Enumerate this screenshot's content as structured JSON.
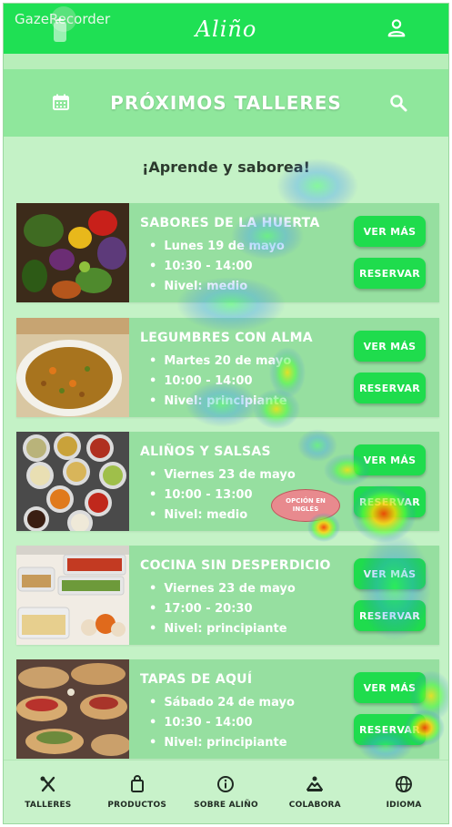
{
  "header": {
    "brand": "Aliño",
    "watermark": "GazeRecorder",
    "user_icon": "user-icon",
    "colors": {
      "header": "#1fe054",
      "background": "#c4f2c6",
      "button": "#1fdc4d"
    }
  },
  "section": {
    "title": "PRÓXIMOS TALLERES",
    "calendar_icon": "calendar-icon",
    "search_icon": "search-icon"
  },
  "tagline": "¡Aprende y saborea!",
  "workshops": [
    {
      "title": "SABORES DE LA HUERTA",
      "date": "Lunes 19 de mayo",
      "time": "10:30 - 14:00",
      "level": "Nivel: medio",
      "more": "VER MÁS",
      "reserve": "RESERVAR"
    },
    {
      "title": "LEGUMBRES CON ALMA",
      "date": "Martes 20 de mayo",
      "time": "10:00 - 14:00",
      "level": "Nivel: principiante",
      "more": "VER MÁS",
      "reserve": "RESERVAR"
    },
    {
      "title": "ALIÑOS Y SALSAS",
      "date": "Viernes 23 de mayo",
      "time": "10:00 - 13:00",
      "level": "Nivel: medio",
      "more": "VER MÁS",
      "reserve": "RESERVAR",
      "tip": "OPCIÓN EN INGLÉS"
    },
    {
      "title": "COCINA SIN DESPERDICIO",
      "date": "Viernes 23 de mayo",
      "time": "17:00 - 20:30",
      "level": "Nivel: principiante",
      "more": "VER MÁS",
      "reserve": "RESERVAR"
    },
    {
      "title": "TAPAS DE AQUÍ",
      "date": "Sábado 24 de mayo",
      "time": "10:30 - 14:00",
      "level": "Nivel: principiante",
      "more": "VER MÁS",
      "reserve": "RESERVAR"
    }
  ],
  "nav": [
    {
      "label": "TALLERES",
      "icon": "utensils-icon"
    },
    {
      "label": "PRODUCTOS",
      "icon": "shopping-bag-icon"
    },
    {
      "label": "SOBRE ALIÑO",
      "icon": "info-icon"
    },
    {
      "label": "COLABORA",
      "icon": "handshake-icon"
    },
    {
      "label": "IDIOMA",
      "icon": "globe-icon"
    }
  ]
}
